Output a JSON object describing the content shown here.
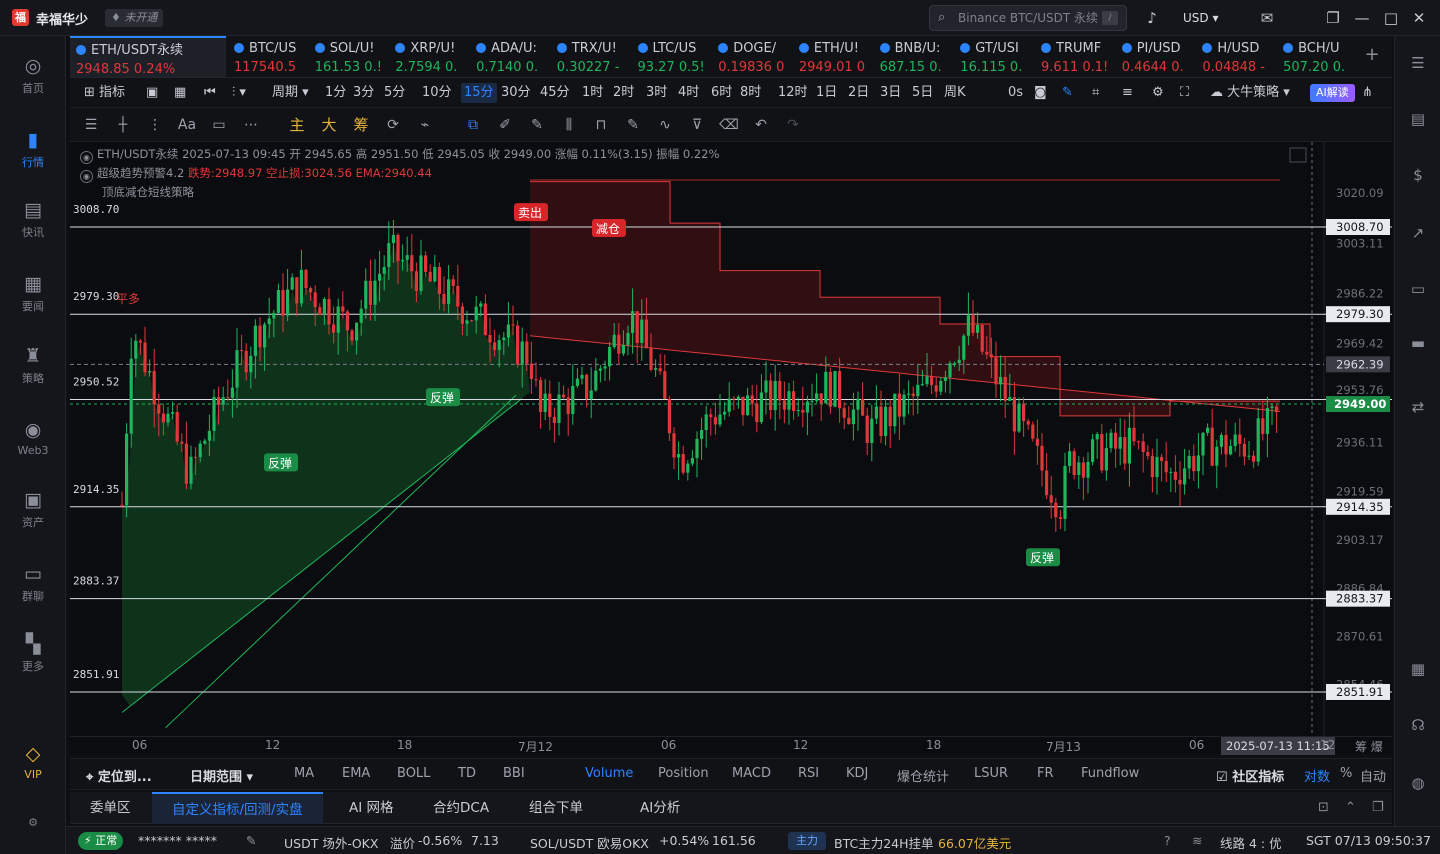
{
  "app": {
    "title": "幸福华少",
    "badge": "未开通",
    "search_placeholder": "Binance BTC/USDT 永续",
    "search_kbd": "/",
    "currency": "USD"
  },
  "leftbar": [
    {
      "label": "首页",
      "icon": "home-icon",
      "glyph": "◎"
    },
    {
      "label": "行情",
      "icon": "market-icon",
      "glyph": "▮",
      "active": true
    },
    {
      "label": "快讯",
      "icon": "news-icon",
      "glyph": "▤"
    },
    {
      "label": "要闻",
      "icon": "headlines-icon",
      "glyph": "▦"
    },
    {
      "label": "策略",
      "icon": "strategy-icon",
      "glyph": "♜"
    },
    {
      "label": "Web3",
      "icon": "web3-icon",
      "glyph": "◉"
    },
    {
      "label": "资产",
      "icon": "assets-icon",
      "glyph": "▣"
    },
    {
      "label": "群聊",
      "icon": "chat-icon",
      "glyph": "▭"
    },
    {
      "label": "更多",
      "icon": "more-icon",
      "glyph": "▚"
    },
    {
      "label": "VIP",
      "icon": "vip-icon",
      "glyph": "◇",
      "vip": true
    }
  ],
  "tickers": [
    {
      "sym": "ETH/USDT永续",
      "px": "2948.85 0.24%",
      "dir": "dn",
      "active": true
    },
    {
      "sym": "BTC/US",
      "px": "117540.5",
      "dir": "dn"
    },
    {
      "sym": "SOL/U!",
      "px": "161.53 0.!",
      "dir": "up"
    },
    {
      "sym": "XRP/U!",
      "px": "2.7594 0.",
      "dir": "up"
    },
    {
      "sym": "ADA/U:",
      "px": "0.7140 0.",
      "dir": "up"
    },
    {
      "sym": "TRX/U!",
      "px": "0.30227 -",
      "dir": "up"
    },
    {
      "sym": "LTC/US",
      "px": "93.27 0.5!",
      "dir": "up"
    },
    {
      "sym": "DOGE/",
      "px": "0.19836 0",
      "dir": "dn"
    },
    {
      "sym": "ETH/U!",
      "px": "2949.01 0",
      "dir": "dn"
    },
    {
      "sym": "BNB/U:",
      "px": "687.15 0.",
      "dir": "up"
    },
    {
      "sym": "GT/USI",
      "px": "16.115 0.",
      "dir": "up"
    },
    {
      "sym": "TRUMF",
      "px": "9.611 0.1!",
      "dir": "dn"
    },
    {
      "sym": "PI/USD",
      "px": "0.4644 0.",
      "dir": "dn"
    },
    {
      "sym": "H/USD",
      "px": "0.04848 -",
      "dir": "dn"
    },
    {
      "sym": "BCH/U",
      "px": "507.20 0.",
      "dir": "up"
    }
  ],
  "toolbar1": {
    "indicator": "指标",
    "period": "周期",
    "intervals": [
      "1分",
      "3分",
      "5分",
      "10分",
      "15分",
      "30分",
      "45分",
      "1时",
      "2时",
      "3时",
      "4时",
      "6时",
      "8时",
      "12时",
      "1日",
      "2日",
      "3日",
      "5日",
      "周K"
    ],
    "selected": "15分",
    "countdown": "0s",
    "strategy": "大牛策略",
    "ai": "AI解读"
  },
  "toolbar2": {
    "main": "主",
    "big": "大",
    "chip": "筹"
  },
  "legend": {
    "line1": "ETH/USDT永续 2025-07-13 09:45 开 2945.65 高 2951.50 低 2945.05 收 2949.00 涨幅 0.11%(3.15) 振幅 0.22%",
    "line2_prefix": "超级趋势预警4.2",
    "line2_red": "跌势:2948.97 空止损:3024.56 EMA:2940.44",
    "line3": "顶底减仓短线策略"
  },
  "chart_data": {
    "type": "candlestick",
    "y_ticks": [
      3020.09,
      3003.11,
      2986.22,
      2969.42,
      2953.76,
      2936.11,
      2919.59,
      2903.17,
      2886.84,
      2870.61,
      2854.46
    ],
    "h_lines": [
      {
        "label": "3008.70",
        "value": 3008.7
      },
      {
        "label": "2979.30",
        "value": 2979.3
      },
      {
        "label": "2950.52",
        "value": 2950.52
      },
      {
        "label": "2914.35",
        "value": 2914.35
      },
      {
        "label": "2883.37",
        "value": 2883.37
      },
      {
        "label": "2851.91",
        "value": 2851.91
      }
    ],
    "right_tags": [
      "3008.70",
      "2979.30",
      "2914.35",
      "2883.37",
      "2851.91"
    ],
    "crosshair_price": "2962.39",
    "last_price": "2949.00",
    "x_ticks": [
      "06",
      "12",
      "18",
      "7月12",
      "06",
      "12",
      "18",
      "7月13",
      "06",
      "12"
    ],
    "x_cursor": "2025-07-13 11:15",
    "signals": [
      {
        "text": "平多",
        "kind": "plain-red"
      },
      {
        "text": "卖出",
        "kind": "box-red"
      },
      {
        "text": "减仓",
        "kind": "box-red"
      },
      {
        "text": "反弹",
        "kind": "box-green"
      },
      {
        "text": "反弹",
        "kind": "box-green"
      },
      {
        "text": "反弹",
        "kind": "box-green"
      }
    ]
  },
  "indbar": {
    "locate": "定位到...",
    "range": "日期范围",
    "items": [
      "MA",
      "EMA",
      "BOLL",
      "TD",
      "BBI"
    ],
    "items2": [
      "Volume",
      "Position",
      "MACD",
      "RSI",
      "KDJ",
      "爆仓统计",
      "LSUR",
      "FR",
      "Fundflow"
    ],
    "community": "社区指标",
    "log": "对数",
    "pct": "%",
    "auto": "自动"
  },
  "bottabs": [
    "委单区",
    "自定义指标/回测/实盘",
    "AI 网格",
    "合约DCA",
    "组合下单",
    "AI分析"
  ],
  "status": {
    "normal": "正常",
    "account": "*******  *****",
    "usdt": "USDT 场外-OKX",
    "premium_label": "溢价",
    "premium": "-0.56%",
    "usdt_px": "7.13",
    "sol": "SOL/USDT 欧易OKX",
    "sol_chg": "+0.54%",
    "sol_px": "161.56",
    "main": "主力",
    "btc": "BTC主力24H挂单",
    "btc_val": "66.07亿美元",
    "line": "线路 4 : 优",
    "time": "SGT 07/13 09:50:37"
  },
  "colors": {
    "accent": "#2d84ff",
    "up": "#1fb55c",
    "down": "#e0383a"
  }
}
